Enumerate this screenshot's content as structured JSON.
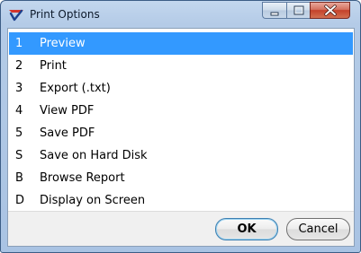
{
  "window": {
    "title": "Print Options"
  },
  "options": [
    {
      "key": "1",
      "label": "Preview",
      "selected": true
    },
    {
      "key": "2",
      "label": "Print",
      "selected": false
    },
    {
      "key": "3",
      "label": "Export (.txt)",
      "selected": false
    },
    {
      "key": "4",
      "label": "View PDF",
      "selected": false
    },
    {
      "key": "5",
      "label": "Save PDF",
      "selected": false
    },
    {
      "key": "S",
      "label": "Save on Hard Disk",
      "selected": false
    },
    {
      "key": "B",
      "label": "Browse Report",
      "selected": false
    },
    {
      "key": "D",
      "label": "Display on Screen",
      "selected": false
    }
  ],
  "buttons": {
    "ok_label": "OK",
    "cancel_label": "Cancel"
  },
  "colors": {
    "selection": "#3399ff",
    "titlebar": "#b4cbe7",
    "close": "#c4412a"
  },
  "icons": {
    "app": "checkmark-app-icon",
    "minimize": "minimize-icon",
    "maximize": "maximize-icon",
    "close": "close-icon"
  }
}
